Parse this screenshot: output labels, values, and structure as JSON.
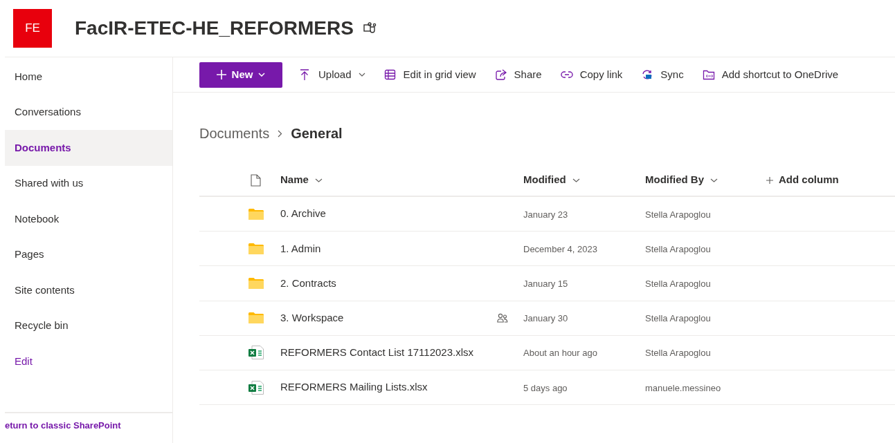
{
  "site": {
    "logo": "FE",
    "title": "FacIR-ETEC-HE_REFORMERS"
  },
  "nav": {
    "items": [
      {
        "label": "Home",
        "kind": "page",
        "selected": false
      },
      {
        "label": "Conversations",
        "kind": "page",
        "selected": false
      },
      {
        "label": "Documents",
        "kind": "page",
        "selected": true
      },
      {
        "label": "Shared with us",
        "kind": "page",
        "selected": false
      },
      {
        "label": "Notebook",
        "kind": "page",
        "selected": false
      },
      {
        "label": "Pages",
        "kind": "page",
        "selected": false
      },
      {
        "label": "Site contents",
        "kind": "page",
        "selected": false
      },
      {
        "label": "Recycle bin",
        "kind": "page",
        "selected": false
      },
      {
        "label": "Edit",
        "kind": "link",
        "selected": false
      }
    ],
    "footer_link": "eturn to classic SharePoint"
  },
  "toolbar": [
    {
      "label": "New",
      "kind": "new"
    },
    {
      "label": "Upload",
      "kind": "upload"
    },
    {
      "label": "Edit in grid view",
      "kind": "grid"
    },
    {
      "label": "Share",
      "kind": "share"
    },
    {
      "label": "Copy link",
      "kind": "link"
    },
    {
      "label": "Sync",
      "kind": "sync"
    },
    {
      "label": "Add shortcut to OneDrive",
      "kind": "shortcut"
    }
  ],
  "breadcrumb": [
    "Documents",
    "General"
  ],
  "table": {
    "columns": [
      "Name",
      "Modified",
      "Modified By"
    ],
    "add_column": "Add column",
    "rows": [
      {
        "kind": "folder",
        "name": "0. Archive",
        "shared": false,
        "modified": "January 23",
        "modified_by": "Stella Arapoglou"
      },
      {
        "kind": "folder",
        "name": "1. Admin",
        "shared": false,
        "modified": "December 4, 2023",
        "modified_by": "Stella Arapoglou"
      },
      {
        "kind": "folder",
        "name": "2. Contracts",
        "shared": false,
        "modified": "January 15",
        "modified_by": "Stella Arapoglou"
      },
      {
        "kind": "folder",
        "name": "3. Workspace",
        "shared": true,
        "modified": "January 30",
        "modified_by": "Stella Arapoglou"
      },
      {
        "kind": "excel",
        "name": "REFORMERS Contact List 17112023.xlsx",
        "shared": false,
        "modified": "About an hour ago",
        "modified_by": "Stella Arapoglou"
      },
      {
        "kind": "excel",
        "name": "REFORMERS Mailing Lists.xlsx",
        "shared": false,
        "modified": "5 days ago",
        "modified_by": "manuele.messineo"
      }
    ]
  }
}
